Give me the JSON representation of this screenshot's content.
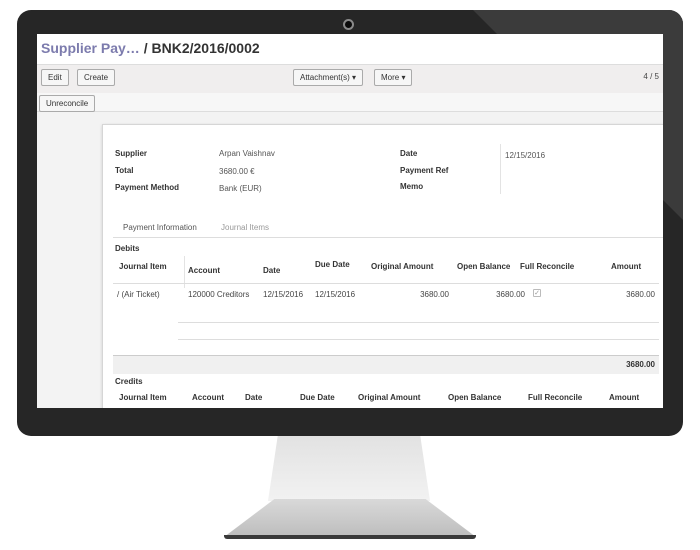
{
  "breadcrumb": {
    "parent": "Supplier Pay…",
    "separator": "/",
    "current": "BNK2/2016/0002"
  },
  "toolbar": {
    "edit": "Edit",
    "create": "Create",
    "attachments": "Attachment(s) ▾",
    "more": "More ▾",
    "pager": "4 / 5"
  },
  "status": {
    "unreconcile": "Unreconcile"
  },
  "form": {
    "supplier_label": "Supplier",
    "supplier_value": "Arpan Vaishnav",
    "total_label": "Total",
    "total_value": "3680.00 €",
    "payment_method_label": "Payment Method",
    "payment_method_value": "Bank (EUR)",
    "date_label": "Date",
    "date_value": "12/15/2016",
    "payment_ref_label": "Payment Ref",
    "memo_label": "Memo"
  },
  "tabs": [
    "Payment Information",
    "Journal Items"
  ],
  "debits": {
    "title": "Debits",
    "columns": [
      "Journal Item",
      "Account",
      "Date",
      "Due Date",
      "Original Amount",
      "Open Balance",
      "Full Reconcile",
      "Amount"
    ],
    "rows": [
      {
        "journal_item": "/ (Air Ticket)",
        "account": "120000 Creditors",
        "date": "12/15/2016",
        "due_date": "12/15/2016",
        "original_amount": "3680.00",
        "open_balance": "3680.00",
        "full_reconcile": "✓",
        "amount": "3680.00"
      }
    ],
    "total": "3680.00"
  },
  "credits": {
    "title": "Credits",
    "columns": [
      "Journal Item",
      "Account",
      "Date",
      "Due Date",
      "Original Amount",
      "Open Balance",
      "Full Reconcile",
      "Amount"
    ]
  }
}
